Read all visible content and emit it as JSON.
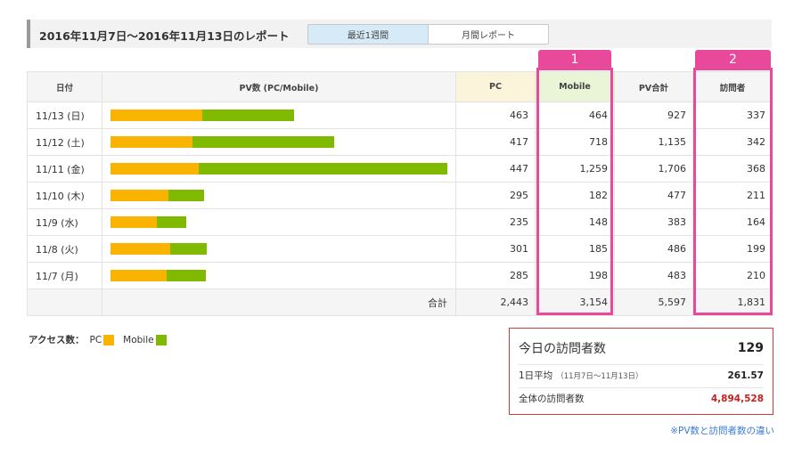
{
  "report": {
    "title": "2016年11月7日〜2016年11月13日のレポート",
    "tabs": [
      {
        "label": "最近1週間",
        "active": true
      },
      {
        "label": "月間レポート",
        "active": false
      }
    ]
  },
  "table": {
    "headers": [
      "日付",
      "PV数 (PC/Mobile)",
      "PC",
      "Mobile",
      "PV合計",
      "訪問者"
    ],
    "rows": [
      {
        "date": "11/13 (日)",
        "pc": 463,
        "mobile": 464,
        "total": 927,
        "visitors": 337,
        "pc_label": "463",
        "mobile_label": "464",
        "total_label": "927",
        "visitors_label": "337"
      },
      {
        "date": "11/12 (土)",
        "pc": 417,
        "mobile": 718,
        "total": 1135,
        "visitors": 342,
        "pc_label": "417",
        "mobile_label": "718",
        "total_label": "1,135",
        "visitors_label": "342"
      },
      {
        "date": "11/11 (金)",
        "pc": 447,
        "mobile": 1259,
        "total": 1706,
        "visitors": 368,
        "pc_label": "447",
        "mobile_label": "1,259",
        "total_label": "1,706",
        "visitors_label": "368"
      },
      {
        "date": "11/10 (木)",
        "pc": 295,
        "mobile": 182,
        "total": 477,
        "visitors": 211,
        "pc_label": "295",
        "mobile_label": "182",
        "total_label": "477",
        "visitors_label": "211"
      },
      {
        "date": "11/9 (水)",
        "pc": 235,
        "mobile": 148,
        "total": 383,
        "visitors": 164,
        "pc_label": "235",
        "mobile_label": "148",
        "total_label": "383",
        "visitors_label": "164"
      },
      {
        "date": "11/8 (火)",
        "pc": 301,
        "mobile": 185,
        "total": 486,
        "visitors": 199,
        "pc_label": "301",
        "mobile_label": "185",
        "total_label": "486",
        "visitors_label": "199"
      },
      {
        "date": "11/7 (月)",
        "pc": 285,
        "mobile": 198,
        "total": 483,
        "visitors": 210,
        "pc_label": "285",
        "mobile_label": "198",
        "total_label": "483",
        "visitors_label": "210"
      }
    ],
    "totals": {
      "label": "合計",
      "pc": "2,443",
      "mobile": "3,154",
      "total": "5,597",
      "visitors": "1,831"
    }
  },
  "highlights": [
    "1",
    "2"
  ],
  "legend": {
    "title": "アクセス数：",
    "pc": "PC",
    "mobile": "Mobile"
  },
  "visitors": {
    "today_label": "今日の訪問者数",
    "today_value": "129",
    "avg_label": "1日平均",
    "avg_range": "（11月7日〜11月13日）",
    "avg_value": "261.57",
    "total_label": "全体の訪問者数",
    "total_value": "4,894,528"
  },
  "link": {
    "label": "※PV数と訪問者数の違い"
  },
  "colors": {
    "pc": "#f8b400",
    "mobile": "#7fb900",
    "highlight": "#e8499a",
    "total_visitors": "#c81e1e"
  }
}
